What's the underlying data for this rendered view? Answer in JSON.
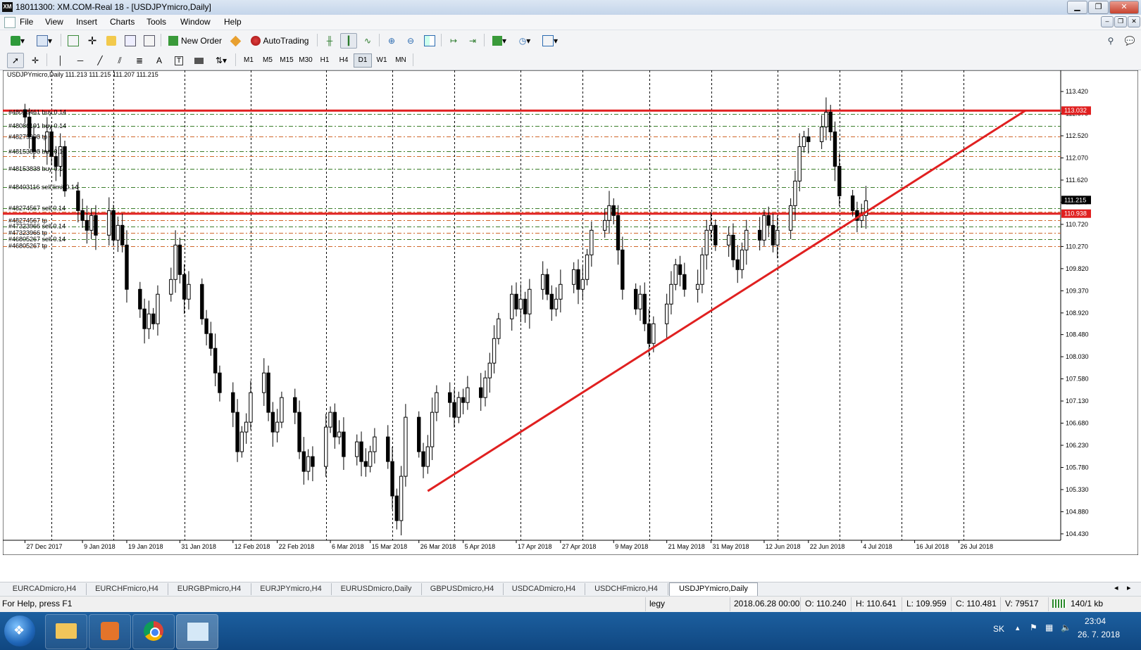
{
  "window": {
    "title": "18011300: XM.COM-Real 18 - [USDJPYmicro,Daily]",
    "app_icon_label": "XM"
  },
  "menu": [
    "File",
    "View",
    "Insert",
    "Charts",
    "Tools",
    "Window",
    "Help"
  ],
  "toolbar": {
    "new_order": "New Order",
    "auto_trading": "AutoTrading"
  },
  "timeframes": [
    "M1",
    "M5",
    "M15",
    "M30",
    "H1",
    "H4",
    "D1",
    "W1",
    "MN"
  ],
  "active_timeframe": "D1",
  "chart": {
    "header": "USDJPYmicro,Daily  111.213 111.215 111.207 111.215",
    "price_ticks": [
      "113.420",
      "112.970",
      "112.520",
      "112.070",
      "111.620",
      "111.170",
      "110.720",
      "110.270",
      "109.820",
      "109.370",
      "108.920",
      "108.480",
      "108.030",
      "107.580",
      "107.130",
      "106.680",
      "106.230",
      "105.780",
      "105.330",
      "104.880",
      "104.430"
    ],
    "price_range": [
      104.3,
      113.85
    ],
    "date_ticks": [
      "27 Dec 2017",
      "9 Jan 2018",
      "19 Jan 2018",
      "31 Jan 2018",
      "12 Feb 2018",
      "22 Feb 2018",
      "6 Mar 2018",
      "15 Mar 2018",
      "26 Mar 2018",
      "5 Apr 2018",
      "17 Apr 2018",
      "27 Apr 2018",
      "9 May 2018",
      "21 May 2018",
      "31 May 2018",
      "12 Jun 2018",
      "22 Jun 2018",
      "4 Jul 2018",
      "16 Jul 2018",
      "26 Jul 2018"
    ],
    "current_price_label": "111.215",
    "current_price": 111.215,
    "resistance_label": "113.032",
    "resistance_price": 113.032,
    "support_label": "110.938",
    "support_price": 110.938,
    "order_labels": [
      {
        "text": "#48086461 buy 0.14",
        "price": 113.0
      },
      {
        "text": "#48086191 buy 0.14",
        "price": 112.72
      },
      {
        "text": "#48279908 tp",
        "price": 112.5
      },
      {
        "text": "#48153898 buy 0.14",
        "price": 112.2
      },
      {
        "text": "#48153838 buy 0.14",
        "price": 111.85
      },
      {
        "text": "#48403116 sell limit 0.14",
        "price": 111.48
      },
      {
        "text": "#48274567 sell 0.14",
        "price": 111.05
      },
      {
        "text": "#48274567 tp",
        "price": 110.8
      },
      {
        "text": "#47323966 sell 0.14",
        "price": 110.68
      },
      {
        "text": "#47323966 tp",
        "price": 110.55
      },
      {
        "text": "#46805267 sell 0.14",
        "price": 110.42
      },
      {
        "text": "#46805267 tp",
        "price": 110.28
      }
    ],
    "level_lines": [
      {
        "price": 112.97,
        "color": "#3a7d2a",
        "style": "dash"
      },
      {
        "price": 112.72,
        "color": "#3a7d2a",
        "style": "dash"
      },
      {
        "price": 112.5,
        "color": "#d0662a",
        "style": "dash"
      },
      {
        "price": 112.2,
        "color": "#3a7d2a",
        "style": "dash"
      },
      {
        "price": 112.1,
        "color": "#d0662a",
        "style": "dash"
      },
      {
        "price": 111.85,
        "color": "#3a7d2a",
        "style": "dash"
      },
      {
        "price": 111.48,
        "color": "#3a7d2a",
        "style": "dash"
      },
      {
        "price": 111.05,
        "color": "#3a7d2a",
        "style": "dash"
      },
      {
        "price": 110.98,
        "color": "#d0662a",
        "style": "dash"
      },
      {
        "price": 110.8,
        "color": "#d0662a",
        "style": "dash"
      },
      {
        "price": 110.68,
        "color": "#3a7d2a",
        "style": "dash"
      },
      {
        "price": 110.55,
        "color": "#d0662a",
        "style": "dash"
      },
      {
        "price": 110.42,
        "color": "#3a7d2a",
        "style": "dash"
      },
      {
        "price": 110.28,
        "color": "#d0662a",
        "style": "dash"
      }
    ],
    "trendline": {
      "from": {
        "date": "28 Mar 2018",
        "price": 105.3
      },
      "to": {
        "date": "10 Aug 2018",
        "price": 113.032
      },
      "color": "#e02020"
    },
    "candles_path": [
      112.9,
      112.5,
      112.2,
      112.6,
      112.1,
      111.9,
      112.3,
      111.4,
      111.0,
      110.8,
      110.6,
      110.9,
      110.5,
      111.0,
      110.4,
      110.7,
      110.3,
      109.4,
      109.0,
      108.6,
      108.9,
      108.7,
      109.3,
      109.6,
      110.3,
      109.7,
      109.2,
      109.5,
      108.8,
      108.5,
      108.2,
      107.7,
      107.3,
      106.9,
      106.1,
      106.5,
      106.7,
      107.3,
      107.7,
      106.9,
      106.5,
      106.7,
      107.2,
      106.9,
      106.1,
      105.7,
      106.0,
      105.8,
      106.6,
      106.9,
      106.4,
      106.5,
      106.0,
      106.3,
      105.9,
      105.8,
      106.1,
      106.4,
      105.9,
      105.2,
      104.7,
      105.6,
      106.8,
      106.1,
      105.8,
      106.2,
      106.9,
      107.3,
      107.1,
      106.8,
      107.2,
      107.1,
      107.4,
      107.2,
      107.6,
      107.9,
      108.4,
      108.8,
      109.3,
      109.0,
      109.2,
      108.9,
      109.4,
      109.7,
      109.3,
      109.0,
      109.2,
      109.5,
      109.8,
      109.4,
      109.6,
      110.1,
      110.6,
      110.8,
      111.1,
      110.9,
      110.2,
      109.4,
      109.0,
      109.3,
      108.7,
      108.3,
      108.7,
      109.1,
      109.5,
      109.9,
      109.7,
      109.4,
      109.5,
      110.1,
      110.6,
      110.7,
      110.3,
      110.5,
      110.0,
      109.8,
      110.2,
      110.6,
      110.4,
      110.9,
      110.7,
      110.3,
      110.6,
      111.1,
      111.6,
      112.3,
      112.5,
      112.4,
      112.7,
      113.0,
      112.6,
      111.9,
      111.3,
      111.0,
      110.8,
      110.9,
      111.2
    ],
    "vertical_grid_dates": [
      "2 Jan 2018",
      "16 Jan 2018",
      "1 Feb 2018",
      "16 Feb 2018",
      "5 Mar 2018",
      "20 Mar 2018",
      "3 Apr 2018",
      "18 Apr 2018",
      "2 May 2018",
      "17 May 2018",
      "31 May 2018",
      "15 Jun 2018",
      "29 Jun 2018",
      "13 Jul 2018",
      "27 Jul 2018"
    ]
  },
  "chart_tabs": [
    "EURCADmicro,H4",
    "EURCHFmicro,H4",
    "EURGBPmicro,H4",
    "EURJPYmicro,H4",
    "EURUSDmicro,Daily",
    "GBPUSDmicro,H4",
    "USDCADmicro,H4",
    "USDCHFmicro,H4",
    "USDJPYmicro,Daily"
  ],
  "active_tab": "USDJPYmicro,Daily",
  "status": {
    "help": "For Help, press F1",
    "profile": "legy",
    "datetime": "2018.06.28 00:00",
    "open": "O: 110.240",
    "high": "H: 110.641",
    "low": "L: 109.959",
    "close": "C: 110.481",
    "volume": "V: 79517",
    "connection": "140/1 kb"
  },
  "taskbar": {
    "language": "SK",
    "time": "23:04",
    "date": "26. 7. 2018"
  }
}
